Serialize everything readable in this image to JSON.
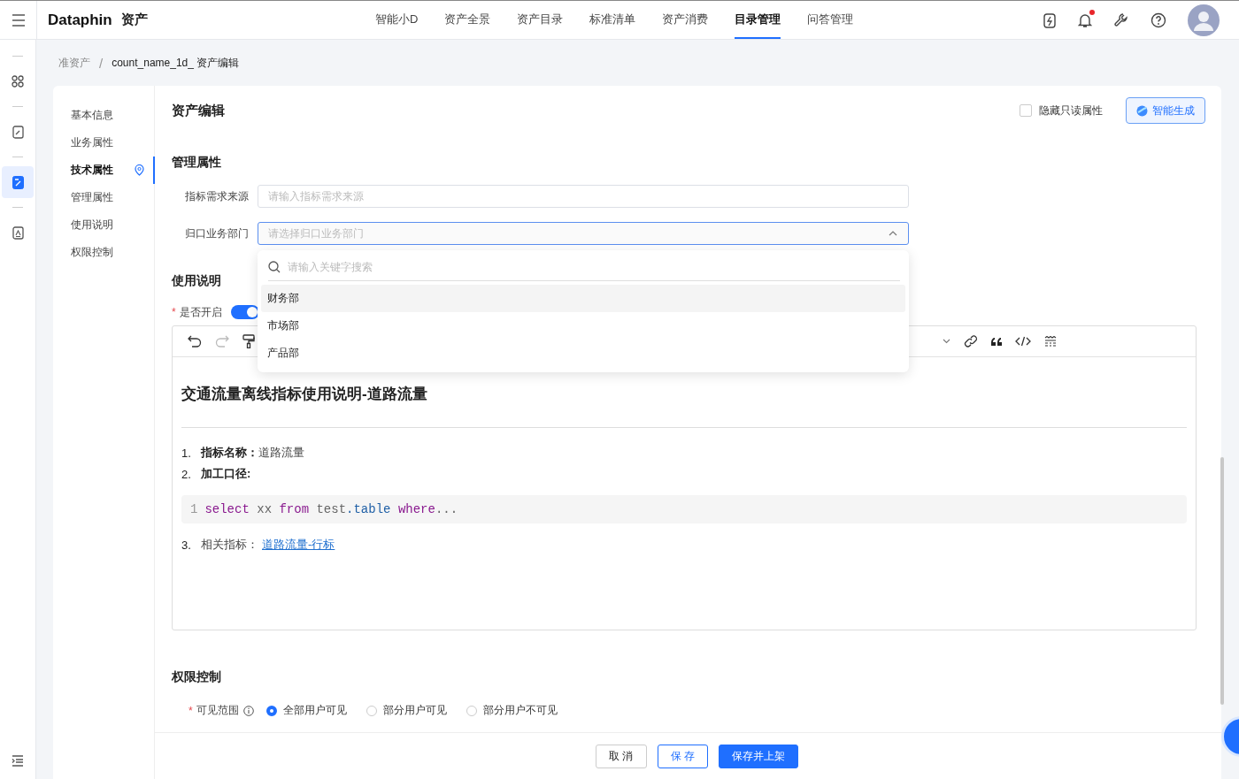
{
  "app": {
    "logo": "Dataphin",
    "product": "资产"
  },
  "nav": [
    {
      "label": "智能小D",
      "selected": false
    },
    {
      "label": "资产全景",
      "selected": false
    },
    {
      "label": "资产目录",
      "selected": false
    },
    {
      "label": "标准清单",
      "selected": false
    },
    {
      "label": "资产消费",
      "selected": false
    },
    {
      "label": "目录管理",
      "selected": true
    },
    {
      "label": "问答管理",
      "selected": false
    }
  ],
  "notifications": {
    "unread": true
  },
  "rail": [
    {
      "kind": "apps",
      "selected": false
    },
    {
      "kind": "edit",
      "selected": false
    },
    {
      "kind": "note",
      "selected": true
    },
    {
      "kind": "doc",
      "selected": false
    }
  ],
  "breadcrumb": [
    "准资产",
    "count_name_1d_ 资产编辑"
  ],
  "breadcrumb_separator": "/",
  "anchors": [
    {
      "label": "基本信息",
      "selected": false
    },
    {
      "label": "业务属性",
      "selected": false
    },
    {
      "label": "技术属性",
      "selected": true
    },
    {
      "label": "管理属性",
      "selected": false
    },
    {
      "label": "使用说明",
      "selected": false
    },
    {
      "label": "权限控制",
      "selected": false
    }
  ],
  "page": {
    "title": "资产编辑",
    "hide_readonly": {
      "label": "隐藏只读属性",
      "checked": false
    },
    "ai_button": "智能生成"
  },
  "management": {
    "title": "管理属性",
    "fields": [
      {
        "kind": "input",
        "label": "指标需求来源",
        "placeholder": "请输入指标需求来源"
      },
      {
        "kind": "select",
        "label": "归口业务部门",
        "placeholder": "请选择归口业务部门",
        "expanded": true
      }
    ]
  },
  "dropdown": {
    "search_placeholder": "请输入关键字搜索",
    "options": [
      {
        "label": "财务部",
        "selected": true
      },
      {
        "label": "市场部",
        "selected": false
      },
      {
        "label": "产品部",
        "selected": false
      }
    ]
  },
  "usage": {
    "title": "使用说明",
    "toggle": {
      "label": "是否开启",
      "required_mark": "*",
      "on": true
    },
    "editor": {
      "heading": "交通流量离线指标使用说明-道路流量",
      "blocks": [
        {
          "kind": "item",
          "number": "1.",
          "label": "指标名称：",
          "strong": true,
          "value": "道路流量"
        },
        {
          "kind": "item",
          "number": "2.",
          "label": "加工口径:",
          "strong": true
        },
        {
          "kind": "code",
          "line": "1",
          "tokens": [
            {
              "text": "select",
              "kind": "keyword"
            },
            {
              "text": " xx ",
              "kind": "plain"
            },
            {
              "text": "from",
              "kind": "keyword"
            },
            {
              "text": " test",
              "kind": "plain"
            },
            {
              "text": ".table",
              "kind": "property"
            },
            {
              "text": " where",
              "kind": "keyword"
            },
            {
              "text": "...",
              "kind": "plain"
            }
          ]
        },
        {
          "kind": "item",
          "number": "3.",
          "label": "相关指标：",
          "strong": false,
          "link": "道路流量-行标"
        }
      ]
    }
  },
  "permission": {
    "title": "权限控制",
    "field": {
      "label": "可见范围",
      "required_mark": "*",
      "options": [
        {
          "label": "全部用户可见",
          "selected": true
        },
        {
          "label": "部分用户可见",
          "selected": false
        },
        {
          "label": "部分用户不可见",
          "selected": false
        }
      ]
    }
  },
  "footer": [
    {
      "kind": "default",
      "label": "取 消"
    },
    {
      "kind": "outline",
      "label": "保 存"
    },
    {
      "kind": "primary",
      "label": "保存并上架"
    }
  ]
}
